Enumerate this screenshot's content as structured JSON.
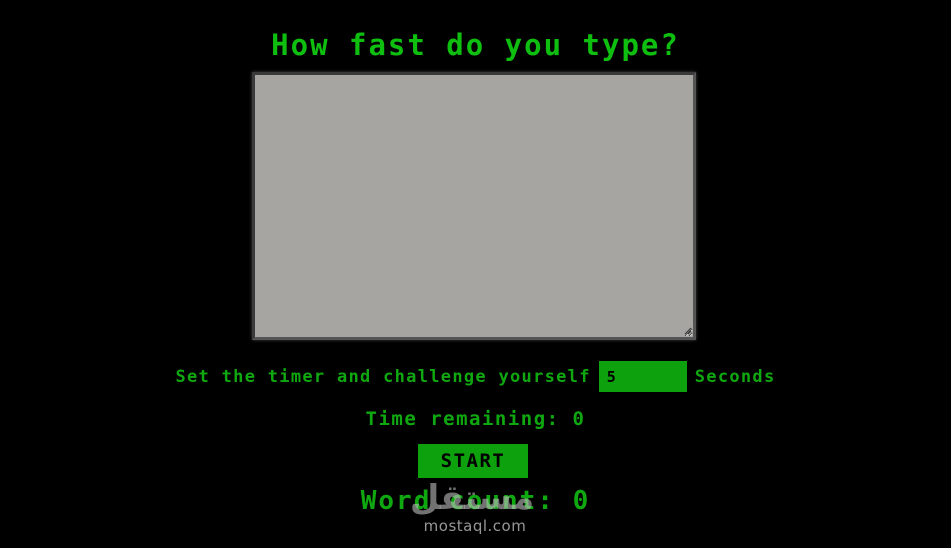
{
  "title": "How fast do you type?",
  "typing_area": {
    "value": ""
  },
  "timer": {
    "prefix_label": "Set the timer and challenge yourself",
    "input_value": "5",
    "suffix_label": "Seconds"
  },
  "time_remaining": {
    "text": "Time remaining: 0"
  },
  "start_button": {
    "label": "START"
  },
  "word_count": {
    "text": "Word count: 0"
  },
  "watermark": {
    "logo_text": "مستقل",
    "site_text": "mostaql.com"
  },
  "colors": {
    "background": "#000000",
    "accent_green": "#0ea10e",
    "text_green": "#10a810",
    "textarea_gray": "#a6a5a2"
  }
}
